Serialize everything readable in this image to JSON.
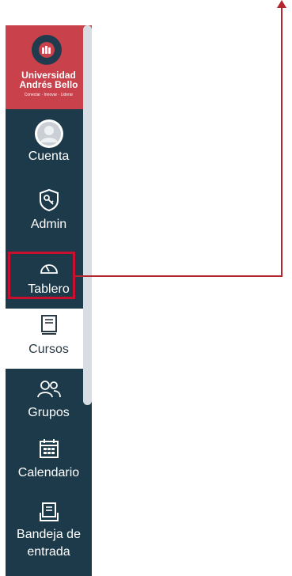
{
  "logo": {
    "line1": "Universidad",
    "line2": "Andrés Bello",
    "tagline": "Conectar · Innovar · Liderar"
  },
  "nav": {
    "items": [
      {
        "label": "Cuenta",
        "icon": "user-avatar-icon"
      },
      {
        "label": "Admin",
        "icon": "admin-shield-icon"
      },
      {
        "label": "Tablero",
        "icon": "dashboard-icon"
      },
      {
        "label": "Cursos",
        "icon": "courses-book-icon"
      },
      {
        "label": "Grupos",
        "icon": "groups-icon"
      },
      {
        "label": "Calendario",
        "icon": "calendar-icon"
      },
      {
        "label": "Bandeja de",
        "label2": "entrada",
        "icon": "inbox-icon"
      }
    ]
  },
  "colors": {
    "nav_bg": "#1d3a4a",
    "brand_red": "#c8414b",
    "highlight": "#c8102e"
  }
}
